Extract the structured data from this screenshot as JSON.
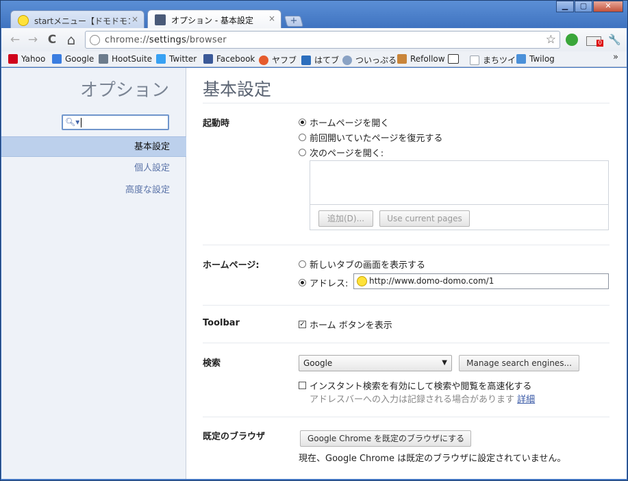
{
  "window": {
    "tabs": [
      {
        "label": "startメニュー【ドモドモコーポ…",
        "close": "×"
      },
      {
        "label": "オプション - 基本設定",
        "close": "×"
      }
    ],
    "new_tab": "+",
    "min": "▁",
    "max": "▢",
    "close": "✕"
  },
  "toolbar": {
    "back": "←",
    "forward": "→",
    "reload": "C",
    "home": "⌂",
    "url_prefix": "chrome://",
    "url_host": "settings",
    "url_path": "/browser",
    "star": "☆",
    "badge": "0",
    "wrench": "🔧"
  },
  "bookmarks": [
    {
      "label": "Yahoo",
      "icon": "yahoo-icon",
      "color": "#d0021b"
    },
    {
      "label": "Google",
      "icon": "google-icon",
      "color": "#3a7de0"
    },
    {
      "label": "HootSuite",
      "icon": "hootsuite-icon",
      "color": "#6b7b8c"
    },
    {
      "label": "Twitter",
      "icon": "twitter-icon",
      "color": "#38a1f3"
    },
    {
      "label": "Facebook",
      "icon": "facebook-icon",
      "color": "#3b5998"
    },
    {
      "label": "ヤフブ",
      "icon": "yahoo-bookmark-icon",
      "color": "#e55b2d"
    },
    {
      "label": "はてブ",
      "icon": "hatena-icon",
      "color": "#2c6ebd"
    },
    {
      "label": "ついっぷる",
      "icon": "twipple-icon",
      "color": "#8aa2c4"
    },
    {
      "label": "Refollow",
      "icon": "refollow-icon",
      "color": "#c9853a"
    },
    {
      "label": "",
      "icon": "fof-icon",
      "color": "#333333"
    },
    {
      "label": "まちツイ",
      "icon": "page-icon",
      "color": "#9aa3ad"
    },
    {
      "label": "Twilog",
      "icon": "twilog-icon",
      "color": "#4a90d9"
    }
  ],
  "bookmarks_more": "»",
  "sidebar": {
    "title": "オプション",
    "search_placeholder": "",
    "items": [
      {
        "label": "基本設定",
        "selected": true
      },
      {
        "label": "個人設定",
        "selected": false
      },
      {
        "label": "高度な設定",
        "selected": false
      }
    ]
  },
  "main": {
    "title": "基本設定",
    "startup": {
      "label": "起動時",
      "options": [
        "ホームページを開く",
        "前回開いていたページを復元する",
        "次のページを開く:"
      ],
      "selected_index": 0,
      "add_button": "追加(D)...",
      "use_current_button": "Use current pages"
    },
    "homepage": {
      "label": "ホームページ:",
      "new_tab_option": "新しいタブの画面を表示する",
      "address_option": "アドレス:",
      "address_value": "http://www.domo-domo.com/1"
    },
    "toolbar_section": {
      "label": "Toolbar",
      "show_home": "ホーム ボタンを表示",
      "show_home_checked": true
    },
    "search": {
      "label": "検索",
      "engine": "Google",
      "manage_button": "Manage search engines...",
      "instant": "インスタント検索を有効にして検索や閲覧を高速化する",
      "instant_checked": false,
      "note": "アドレスバーへの入力は記録される場合があります",
      "more_link": "詳細"
    },
    "default_browser": {
      "label": "既定のブラウザ",
      "button": "Google Chrome を既定のブラウザにする",
      "status": "現在、Google Chrome は既定のブラウザに設定されていません。"
    }
  }
}
